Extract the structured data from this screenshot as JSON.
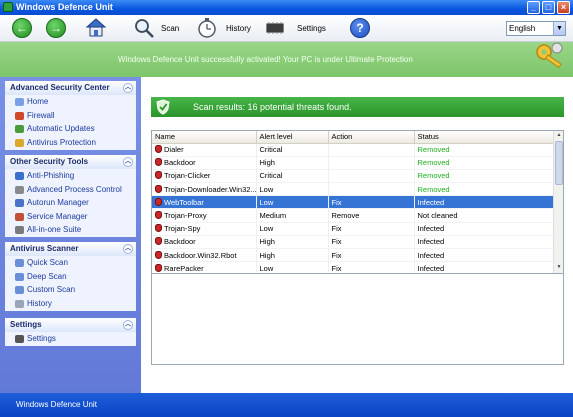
{
  "window": {
    "title": "Windows Defence Unit"
  },
  "toolbar": {
    "back_icon": "back-arrow-icon",
    "forward_icon": "forward-arrow-icon",
    "home_icon": "home-icon",
    "scan_label": "Scan",
    "history_label": "History",
    "settings_label": "Settings",
    "help_label": "?",
    "language": "English"
  },
  "banner": {
    "text": "Windows Defence Unit successfully activated! Your PC is under Ultimate Protection"
  },
  "sidebar": {
    "panels": [
      {
        "title": "Advanced Security Center",
        "items": [
          "Home",
          "Firewall",
          "Automatic Updates",
          "Antivirus Protection"
        ]
      },
      {
        "title": "Other Security Tools",
        "items": [
          "Anti-Phishing",
          "Advanced Process Control",
          "Autorun Manager",
          "Service Manager",
          "All-in-one Suite"
        ]
      },
      {
        "title": "Antivirus Scanner",
        "items": [
          "Quick Scan",
          "Deep Scan",
          "Custom Scan",
          "History"
        ]
      },
      {
        "title": "Settings",
        "items": [
          "Settings"
        ]
      }
    ]
  },
  "results": {
    "text": "Scan results: 16 potential threats found."
  },
  "table": {
    "headers": [
      "Name",
      "Alert level",
      "Action",
      "Status"
    ],
    "rows": [
      [
        "Dialer",
        "Critical",
        "",
        "Removed"
      ],
      [
        "Backdoor",
        "High",
        "",
        "Removed"
      ],
      [
        "Trojan-Clicker",
        "Critical",
        "",
        "Removed"
      ],
      [
        "Trojan-Downloader.Win32...",
        "Low",
        "",
        "Removed"
      ],
      [
        "WebToolbar",
        "Low",
        "Fix",
        "Infected"
      ],
      [
        "Trojan-Proxy",
        "Medium",
        "Remove",
        "Not cleaned"
      ],
      [
        "Trojan-Spy",
        "Low",
        "Fix",
        "Infected"
      ],
      [
        "Backdoor",
        "High",
        "Fix",
        "Infected"
      ],
      [
        "Backdoor.Win32.Rbot",
        "High",
        "Fix",
        "Infected"
      ],
      [
        "RarePacker",
        "Low",
        "Fix",
        "Infected"
      ]
    ],
    "selected_row": 4
  },
  "statusbar": {
    "text": "Windows Defence Unit"
  },
  "colors": {
    "accent_green": "#2b952b",
    "removed_green": "#21b021",
    "selection_blue": "#3574d4",
    "sidebar_blue": "#6a82de"
  }
}
